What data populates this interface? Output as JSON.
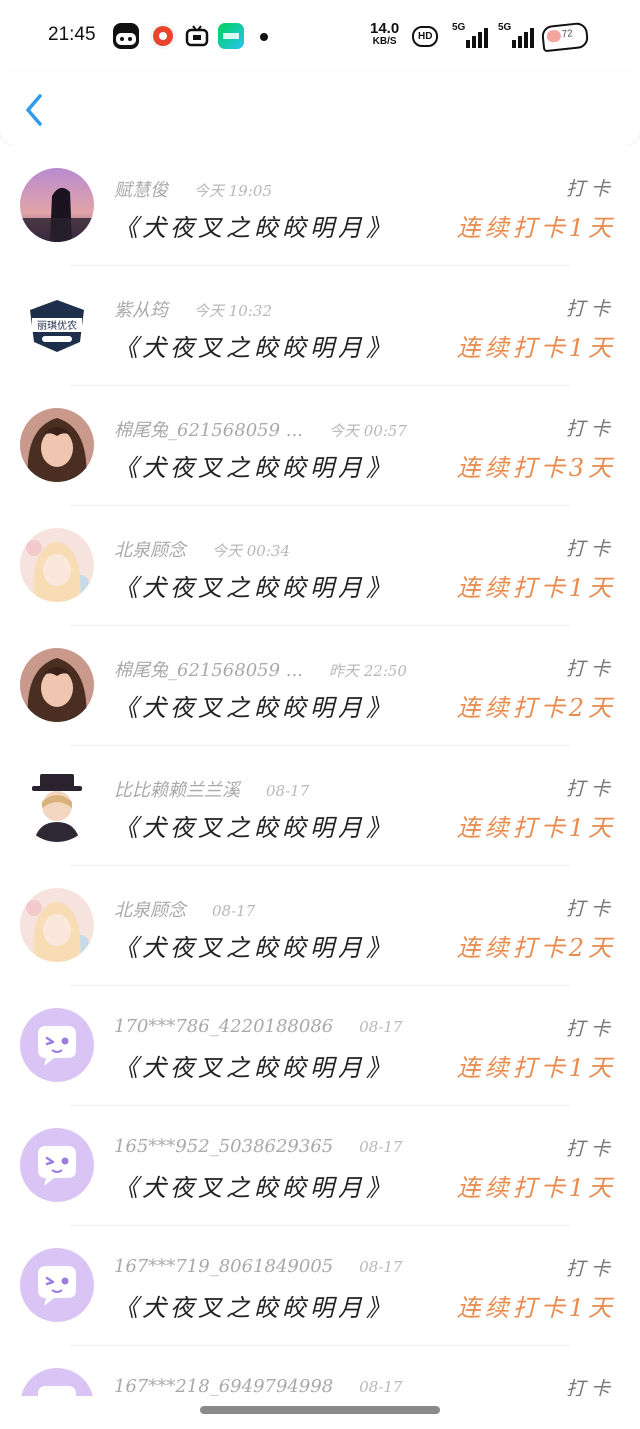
{
  "status_bar": {
    "time": "21:45",
    "net_speed": "14.0",
    "net_unit": "KB/S",
    "hd": "HD",
    "sim1": "5G",
    "sim2": "5G",
    "battery": "72"
  },
  "header": {
    "back_icon": "chevron-left-icon",
    "accent": "#2f9bea"
  },
  "colors": {
    "streak": "#e88b4e",
    "avatar_default": "#d9c4f5"
  },
  "rows": [
    {
      "name": "赋慧俊",
      "time": "今天 19:05",
      "book": "《犬夜叉之皎皎明月》",
      "tag": "打卡",
      "streak": "连续打卡1天",
      "avatar": "photo-dark"
    },
    {
      "name": "紫从筠",
      "time": "今天 10:32",
      "book": "《犬夜叉之皎皎明月》",
      "tag": "打卡",
      "streak": "连续打卡1天",
      "avatar": "logo"
    },
    {
      "name": "棉尾兔_621568059 ...",
      "time": "今天 00:57",
      "book": "《犬夜叉之皎皎明月》",
      "tag": "打卡",
      "streak": "连续打卡3天",
      "avatar": "anime-brown"
    },
    {
      "name": "北泉顾念",
      "time": "今天 00:34",
      "book": "《犬夜叉之皎皎明月》",
      "tag": "打卡",
      "streak": "连续打卡1天",
      "avatar": "anime-light"
    },
    {
      "name": "棉尾兔_621568059 ...",
      "time": "昨天 22:50",
      "book": "《犬夜叉之皎皎明月》",
      "tag": "打卡",
      "streak": "连续打卡2天",
      "avatar": "anime-brown"
    },
    {
      "name": "比比赖赖兰兰溪",
      "time": "08-17",
      "book": "《犬夜叉之皎皎明月》",
      "tag": "打卡",
      "streak": "连续打卡1天",
      "avatar": "anime-hat"
    },
    {
      "name": "北泉顾念",
      "time": "08-17",
      "book": "《犬夜叉之皎皎明月》",
      "tag": "打卡",
      "streak": "连续打卡2天",
      "avatar": "anime-light"
    },
    {
      "name": "170***786_4220188086",
      "time": "08-17",
      "book": "《犬夜叉之皎皎明月》",
      "tag": "打卡",
      "streak": "连续打卡1天",
      "avatar": "default"
    },
    {
      "name": "165***952_5038629365",
      "time": "08-17",
      "book": "《犬夜叉之皎皎明月》",
      "tag": "打卡",
      "streak": "连续打卡1天",
      "avatar": "default"
    },
    {
      "name": "167***719_8061849005",
      "time": "08-17",
      "book": "《犬夜叉之皎皎明月》",
      "tag": "打卡",
      "streak": "连续打卡1天",
      "avatar": "default"
    },
    {
      "name": "167***218_6949794998",
      "time": "08-17",
      "book": "",
      "tag": "打卡",
      "streak": "",
      "avatar": "default"
    }
  ]
}
